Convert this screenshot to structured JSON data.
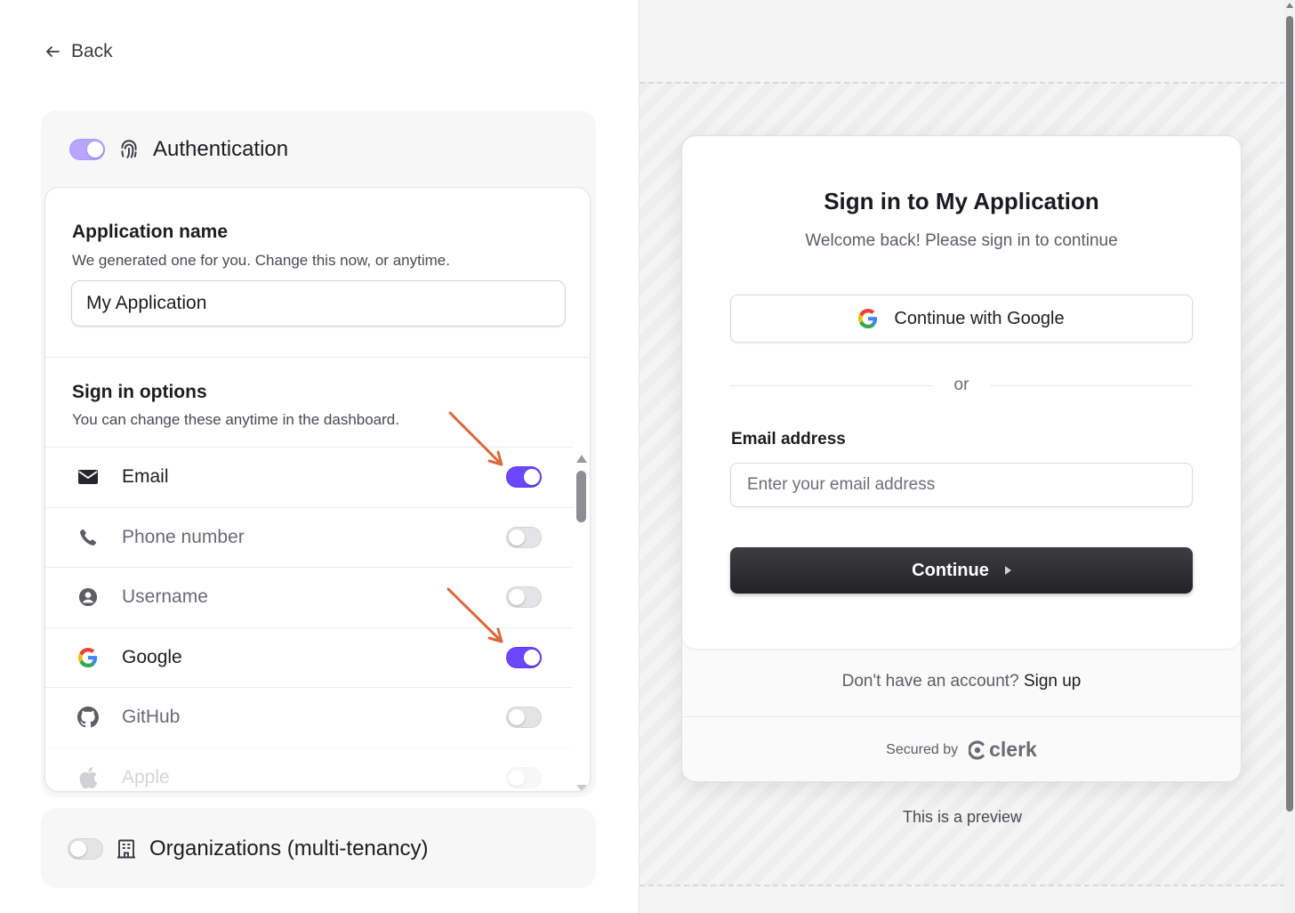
{
  "nav": {
    "back_label": "Back"
  },
  "auth": {
    "title": "Authentication",
    "enabled": true,
    "app_name": {
      "title": "Application name",
      "subtitle": "We generated one for you. Change this now, or anytime.",
      "value": "My Application"
    },
    "sign_in_options": {
      "title": "Sign in options",
      "subtitle": "You can change these anytime in the dashboard.",
      "items": [
        {
          "label": "Email",
          "icon": "envelope-icon",
          "enabled": true
        },
        {
          "label": "Phone number",
          "icon": "phone-icon",
          "enabled": false
        },
        {
          "label": "Username",
          "icon": "user-circle-icon",
          "enabled": false
        },
        {
          "label": "Google",
          "icon": "google-icon",
          "enabled": true
        },
        {
          "label": "GitHub",
          "icon": "github-icon",
          "enabled": false
        },
        {
          "label": "Apple",
          "icon": "apple-icon",
          "enabled": false
        }
      ]
    }
  },
  "organizations": {
    "title": "Organizations (multi-tenancy)",
    "enabled": false
  },
  "preview": {
    "title": "Sign in to My Application",
    "subtitle": "Welcome back! Please sign in to continue",
    "google_button": "Continue with Google",
    "or": "or",
    "email_label": "Email address",
    "email_placeholder": "Enter your email address",
    "continue_button": "Continue",
    "no_account": "Don't have an account?",
    "sign_up": "Sign up",
    "secured_by": "Secured by",
    "brand": "clerk",
    "note": "This is a preview"
  },
  "colors": {
    "accent": "#6c47ff",
    "annotation_arrow": "#d9683f",
    "primary_button": "#2a2a2e"
  }
}
